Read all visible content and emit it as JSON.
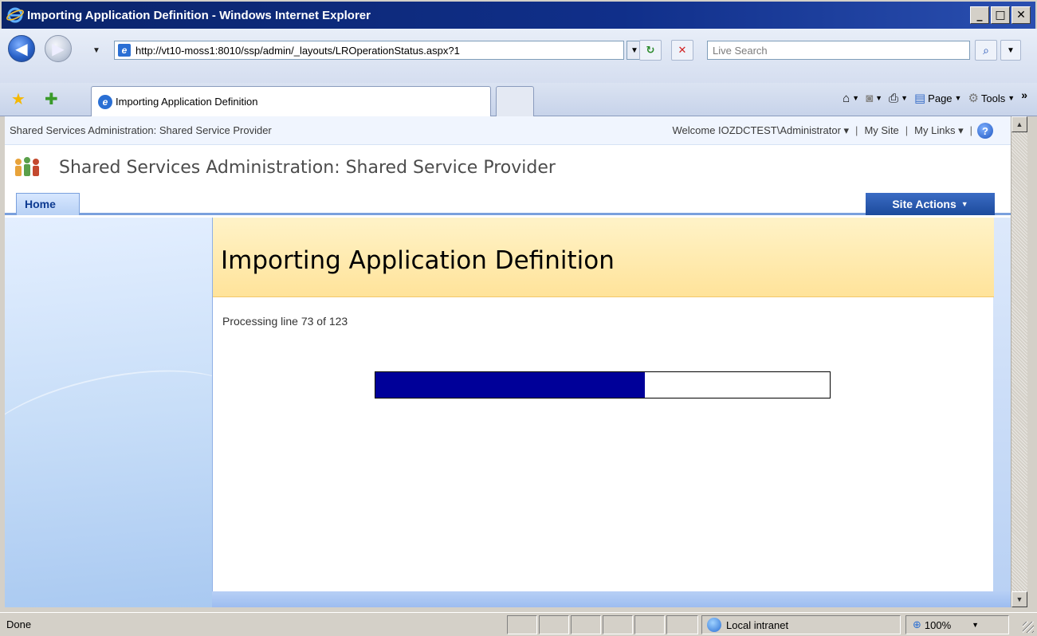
{
  "window": {
    "title": "Importing Application Definition - Windows Internet Explorer",
    "min_label": "_",
    "max_label": "□",
    "close_label": "✕"
  },
  "toolbar": {
    "back_glyph": "◀",
    "forward_glyph": "▶",
    "address": "http://vt10-moss1:8010/ssp/admin/_layouts/LROperationStatus.aspx?1",
    "refresh_glyph": "↻",
    "stop_glyph": "✕",
    "search_placeholder": "Live Search",
    "search_glyph": "⌕"
  },
  "tabbar": {
    "tab_title": "Importing Application Definition",
    "commands": {
      "home_glyph": "⌂",
      "feeds_glyph": "◙",
      "print_glyph": "⎙",
      "page_label": "Page",
      "tools_label": "Tools",
      "chevron": "»"
    }
  },
  "page": {
    "breadcrumb": "Shared Services Administration: Shared Service Provider",
    "welcome": "Welcome IOZDCTEST\\Administrator",
    "my_site": "My Site",
    "my_links": "My Links",
    "help_glyph": "?",
    "site_title": "Shared Services Administration: Shared Service Provider",
    "home_tab": "Home",
    "site_actions": "Site Actions",
    "heading": "Importing Application Definition",
    "status": "Processing line 73 of 123",
    "progress": {
      "current": 73,
      "total": 123,
      "fraction": 0.5935,
      "fill_color": "#000099"
    }
  },
  "statusbar": {
    "status": "Done",
    "zone": "Local intranet",
    "zoom": "100%"
  },
  "colors": {
    "titlebar": "#0a246a",
    "banner": "#ffe39a",
    "site_actions": "#1c4a9c"
  }
}
